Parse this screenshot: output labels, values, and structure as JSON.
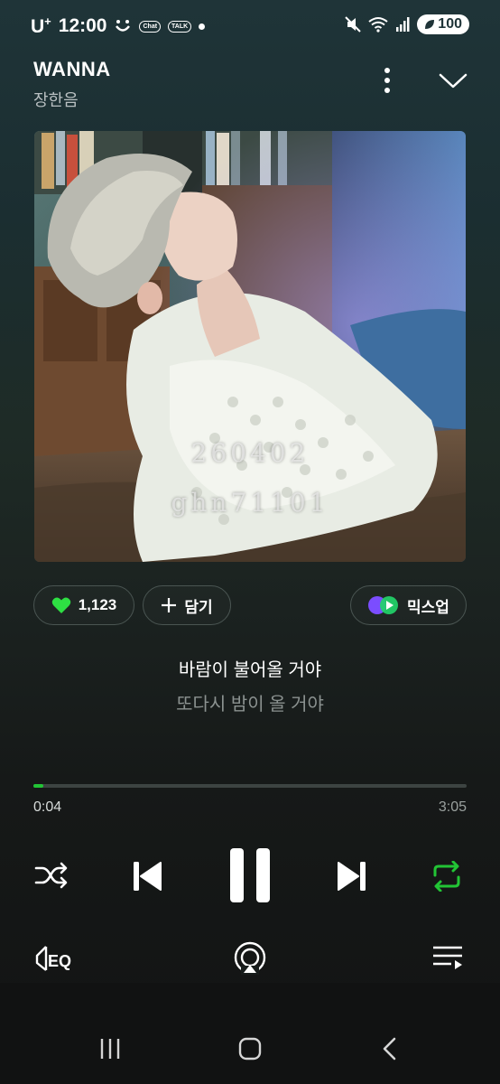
{
  "status_bar": {
    "carrier": "U",
    "carrier_sup": "+",
    "time": "12:00",
    "chat_badge": "Chat",
    "talk_badge": "TALK",
    "battery": "100"
  },
  "header": {
    "title": "WANNA",
    "artist": "장한음"
  },
  "album_art": {
    "watermark_line1": "260402",
    "watermark_line2": "ghn71101"
  },
  "actions": {
    "like_count": "1,123",
    "add_label": "담기",
    "mixup_label": "믹스업"
  },
  "lyrics": {
    "current": "바람이 불어올 거야",
    "next": "또다시 밤이 올 거야"
  },
  "playback": {
    "elapsed": "0:04",
    "total": "3:05",
    "progress_fraction": 0.022,
    "repeat_active": true
  },
  "colors": {
    "accent": "#22c435",
    "like": "#2ee043"
  }
}
